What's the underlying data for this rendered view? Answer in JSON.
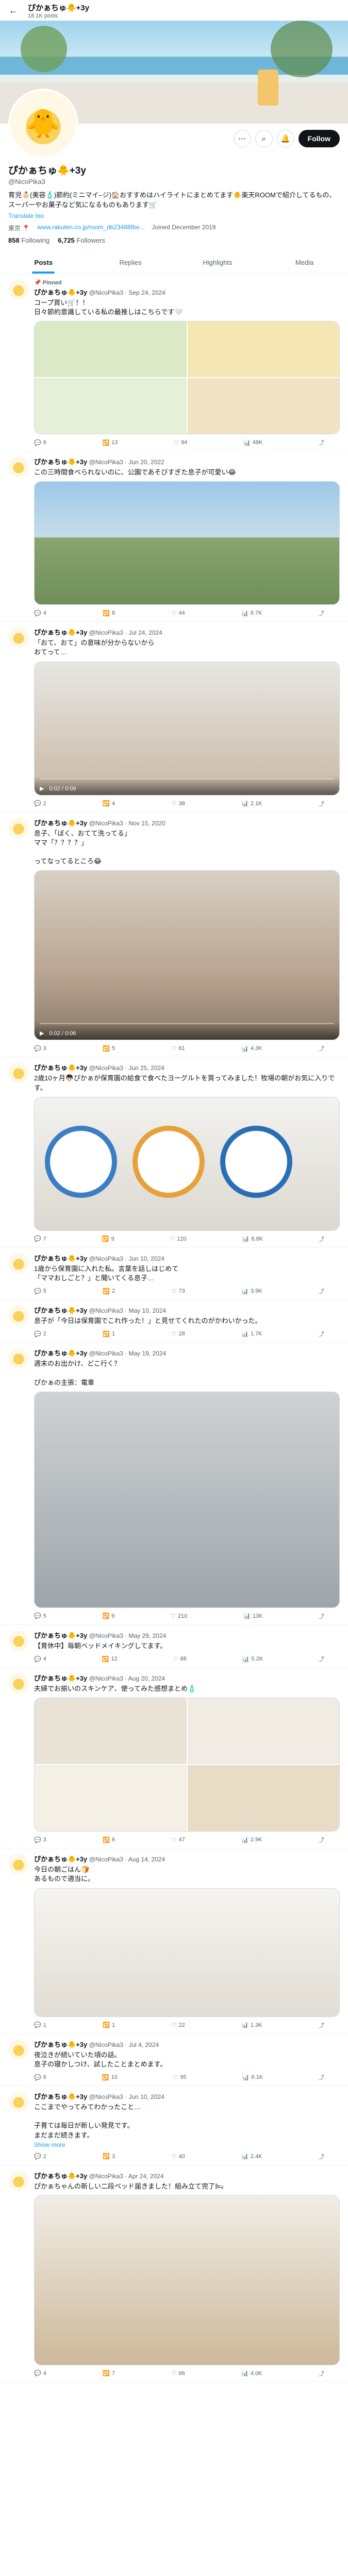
{
  "header": {
    "name": "ぴかぁちゅ🐥+3y",
    "post_count": "18.1K posts"
  },
  "profile": {
    "name": "ぴかぁちゅ🐥+3y",
    "handle": "@NicoPika3",
    "bio": "育児👶🏻(美容🧴)節約(ミニマイ–ジ)🏠おすすめはハイライトにまとめてます🐥楽天ROOMで紹介してるもの、スーパーやお菓子など気になるものもあります🛒",
    "translate": "Translate bio",
    "location": "東京 📍",
    "link": "www.rakuten.co.jp/room_db23488fbe...",
    "joined": "Joined December 2019",
    "following_count": "858",
    "following_label": "Following",
    "followers_count": "6,725",
    "followers_label": "Followers",
    "follow_label": "Follow"
  },
  "tabs": [
    "Posts",
    "Replies",
    "Highlights",
    "Media"
  ],
  "tweets": [
    {
      "pinned": "📌 Pinned",
      "name": "ぴかぁちゅ🐥+3y",
      "handle": "@NicoPika3 · Sep 24, 2024",
      "text": "コープ買い🛒！！\n日々節約意識している私の最推しはこちらです🤍",
      "stats": [
        "6",
        "13",
        "94",
        "48K"
      ]
    },
    {
      "name": "ぴかぁちゅ🐥+3y",
      "handle": "@NicoPika3 · Jun 20, 2022",
      "text": "この三時間食べられないのに、公園であそびすぎた息子が可愛い😂",
      "stats": [
        "4",
        "8",
        "44",
        "6.7K"
      ]
    },
    {
      "name": "ぴかぁちゅ🐥+3y",
      "handle": "@NicoPika3 · Jul 24, 2024",
      "text": "「おて、おて」の意味が分からないから\nおてって…",
      "stats": [
        "2",
        "4",
        "38",
        "2.1K"
      ],
      "video_time": "0:02 / 0:09"
    },
    {
      "name": "ぴかぁちゅ🐥+3y",
      "handle": "@NicoPika3 · Nov 15, 2020",
      "text": "息子、「ぼく、おてて洗ってる」\nママ「？？？？」\n\nってなってるところ😂",
      "stats": [
        "3",
        "5",
        "61",
        "4.3K"
      ],
      "video_time": "0:02 / 0:06"
    },
    {
      "name": "ぴかぁちゅ🐥+3y",
      "handle": "@NicoPika3 · Jun 25, 2024",
      "text": "2歳10ヶ月👦🏻ぴかぁが保育園の給食で食べたヨーグルトを買ってみました！牧場の朝がお気に入りです。",
      "stats": [
        "7",
        "9",
        "120",
        "8.8K"
      ]
    },
    {
      "name": "ぴかぁちゅ🐥+3y",
      "handle": "@NicoPika3 · Jun 10, 2024",
      "text": "1歳から保育園に入れた私。言葉を話しはじめて\n「ママおしごと？」と聞いてくる息子…",
      "stats": [
        "5",
        "2",
        "73",
        "3.9K"
      ]
    },
    {
      "name": "ぴかぁちゅ🐥+3y",
      "handle": "@NicoPika3 · May 10, 2024",
      "text": "息子が「今日は保育園でこれ作った！」と見せてくれたのがかわいかった。",
      "stats": [
        "2",
        "1",
        "28",
        "1.7K"
      ]
    },
    {
      "name": "ぴかぁちゅ🐥+3y",
      "handle": "@NicoPika3 · May 19, 2024",
      "text": "週末のお出かけ、どこ行く？\n\nぴかぁの主張：電車",
      "stats": [
        "5",
        "9",
        "210",
        "13K"
      ]
    },
    {
      "name": "ぴかぁちゅ🐥+3y",
      "handle": "@NicoPika3 · May 29, 2024",
      "text": "【育休中】毎朝ベッドメイキングしてます。",
      "stats": [
        "4",
        "12",
        "88",
        "5.2K"
      ]
    },
    {
      "name": "ぴかぁちゅ🐥+3y",
      "handle": "@NicoPika3 · Aug 20, 2024",
      "text": "夫婦でお揃いのスキンケア、使ってみた感想まとめ🧴",
      "stats": [
        "3",
        "6",
        "47",
        "2.9K"
      ]
    },
    {
      "name": "ぴかぁちゅ🐥+3y",
      "handle": "@NicoPika3 · Aug 14, 2024",
      "text": "今日の朝ごはん🍞\nあるもので適当に。",
      "stats": [
        "1",
        "1",
        "22",
        "1.3K"
      ]
    },
    {
      "name": "ぴかぁちゅ🐥+3y",
      "handle": "@NicoPika3 · Jul 4, 2024",
      "text": "夜泣きが続いていた頃の話。\n息子の寝かしつけ、試したことまとめます。",
      "stats": [
        "6",
        "10",
        "95",
        "6.1K"
      ]
    },
    {
      "name": "ぴかぁちゅ🐥+3y",
      "handle": "@NicoPika3 · Jun 10, 2024",
      "text": "ここまでやってみてわかったこと…\n\n子育ては毎日が新しい発見です。\nまだまだ続きます。",
      "show_more": "Show more",
      "stats": [
        "2",
        "3",
        "40",
        "2.4K"
      ]
    },
    {
      "name": "ぴかぁちゅ🐥+3y",
      "handle": "@NicoPika3 · Apr 24, 2024",
      "text": "ぴかぁちゃんの新しい二段ベッド届きました！組み立て完了🛏",
      "stats": [
        "4",
        "7",
        "66",
        "4.0K"
      ]
    }
  ]
}
